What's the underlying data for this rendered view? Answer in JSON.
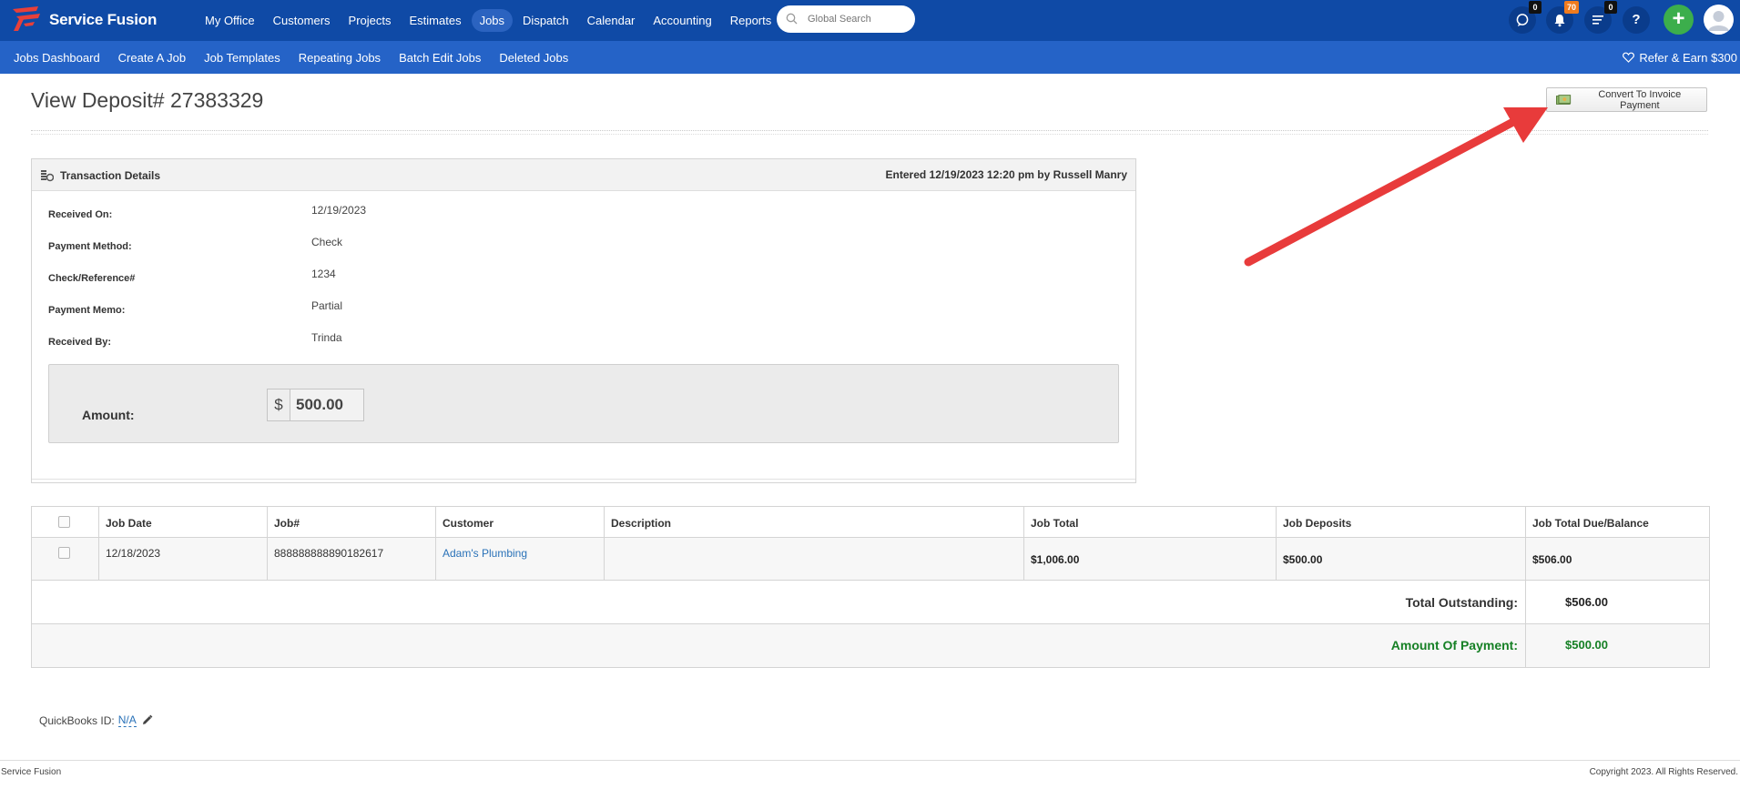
{
  "app": {
    "name": "Service Fusion"
  },
  "topnav": {
    "items": [
      {
        "label": "My Office"
      },
      {
        "label": "Customers"
      },
      {
        "label": "Projects"
      },
      {
        "label": "Estimates"
      },
      {
        "label": "Jobs",
        "active": true
      },
      {
        "label": "Dispatch"
      },
      {
        "label": "Calendar"
      },
      {
        "label": "Accounting"
      },
      {
        "label": "Reports"
      }
    ],
    "search_placeholder": "Global Search",
    "chat_count": "0",
    "notification_count": "70",
    "tasks_count": "0",
    "help_label": "?",
    "add_label": "+"
  },
  "subnav": {
    "items": [
      {
        "label": "Jobs Dashboard"
      },
      {
        "label": "Create A Job"
      },
      {
        "label": "Job Templates"
      },
      {
        "label": "Repeating Jobs"
      },
      {
        "label": "Batch Edit Jobs"
      },
      {
        "label": "Deleted Jobs"
      }
    ],
    "refer_label": "Refer & Earn $300"
  },
  "page": {
    "title": "View Deposit# 27383329",
    "convert_button": "Convert To Invoice Payment"
  },
  "transaction": {
    "title": "Transaction Details",
    "entered": "Entered 12/19/2023 12:20 pm by Russell Manry",
    "fields": [
      {
        "label": "Received On:",
        "value": "12/19/2023"
      },
      {
        "label": "Payment Method:",
        "value": "Check"
      },
      {
        "label": "Check/Reference#",
        "value": "1234"
      },
      {
        "label": "Payment Memo:",
        "value": "Partial"
      },
      {
        "label": "Received By:",
        "value": "Trinda"
      }
    ],
    "amount_label": "Amount:",
    "currency": "$",
    "amount": "500.00"
  },
  "jobs_table": {
    "headers": [
      "Job Date",
      "Job#",
      "Customer",
      "Description",
      "Job Total",
      "Job Deposits",
      "Job Total Due/Balance"
    ],
    "rows": [
      {
        "job_date": "12/18/2023",
        "job_number": "888888888890182617",
        "customer": "Adam's Plumbing",
        "description": "",
        "job_total": "$1,006.00",
        "job_deposits": "$500.00",
        "balance": "$506.00"
      }
    ],
    "total_outstanding_label": "Total Outstanding:",
    "total_outstanding": "$506.00",
    "amount_of_payment_label": "Amount Of Payment:",
    "amount_of_payment": "$500.00"
  },
  "quickbooks": {
    "label": "QuickBooks ID:",
    "value": "N/A"
  },
  "footer": {
    "left": "Service Fusion",
    "right": "Copyright 2023. All Rights Reserved."
  },
  "colors": {
    "nav_bg": "#0f4aa6",
    "subnav_bg": "#2563c7",
    "link": "#2a72b8",
    "payment_green": "#168025",
    "arrow_red": "#e83b3b",
    "add_green": "#3cae4c"
  }
}
